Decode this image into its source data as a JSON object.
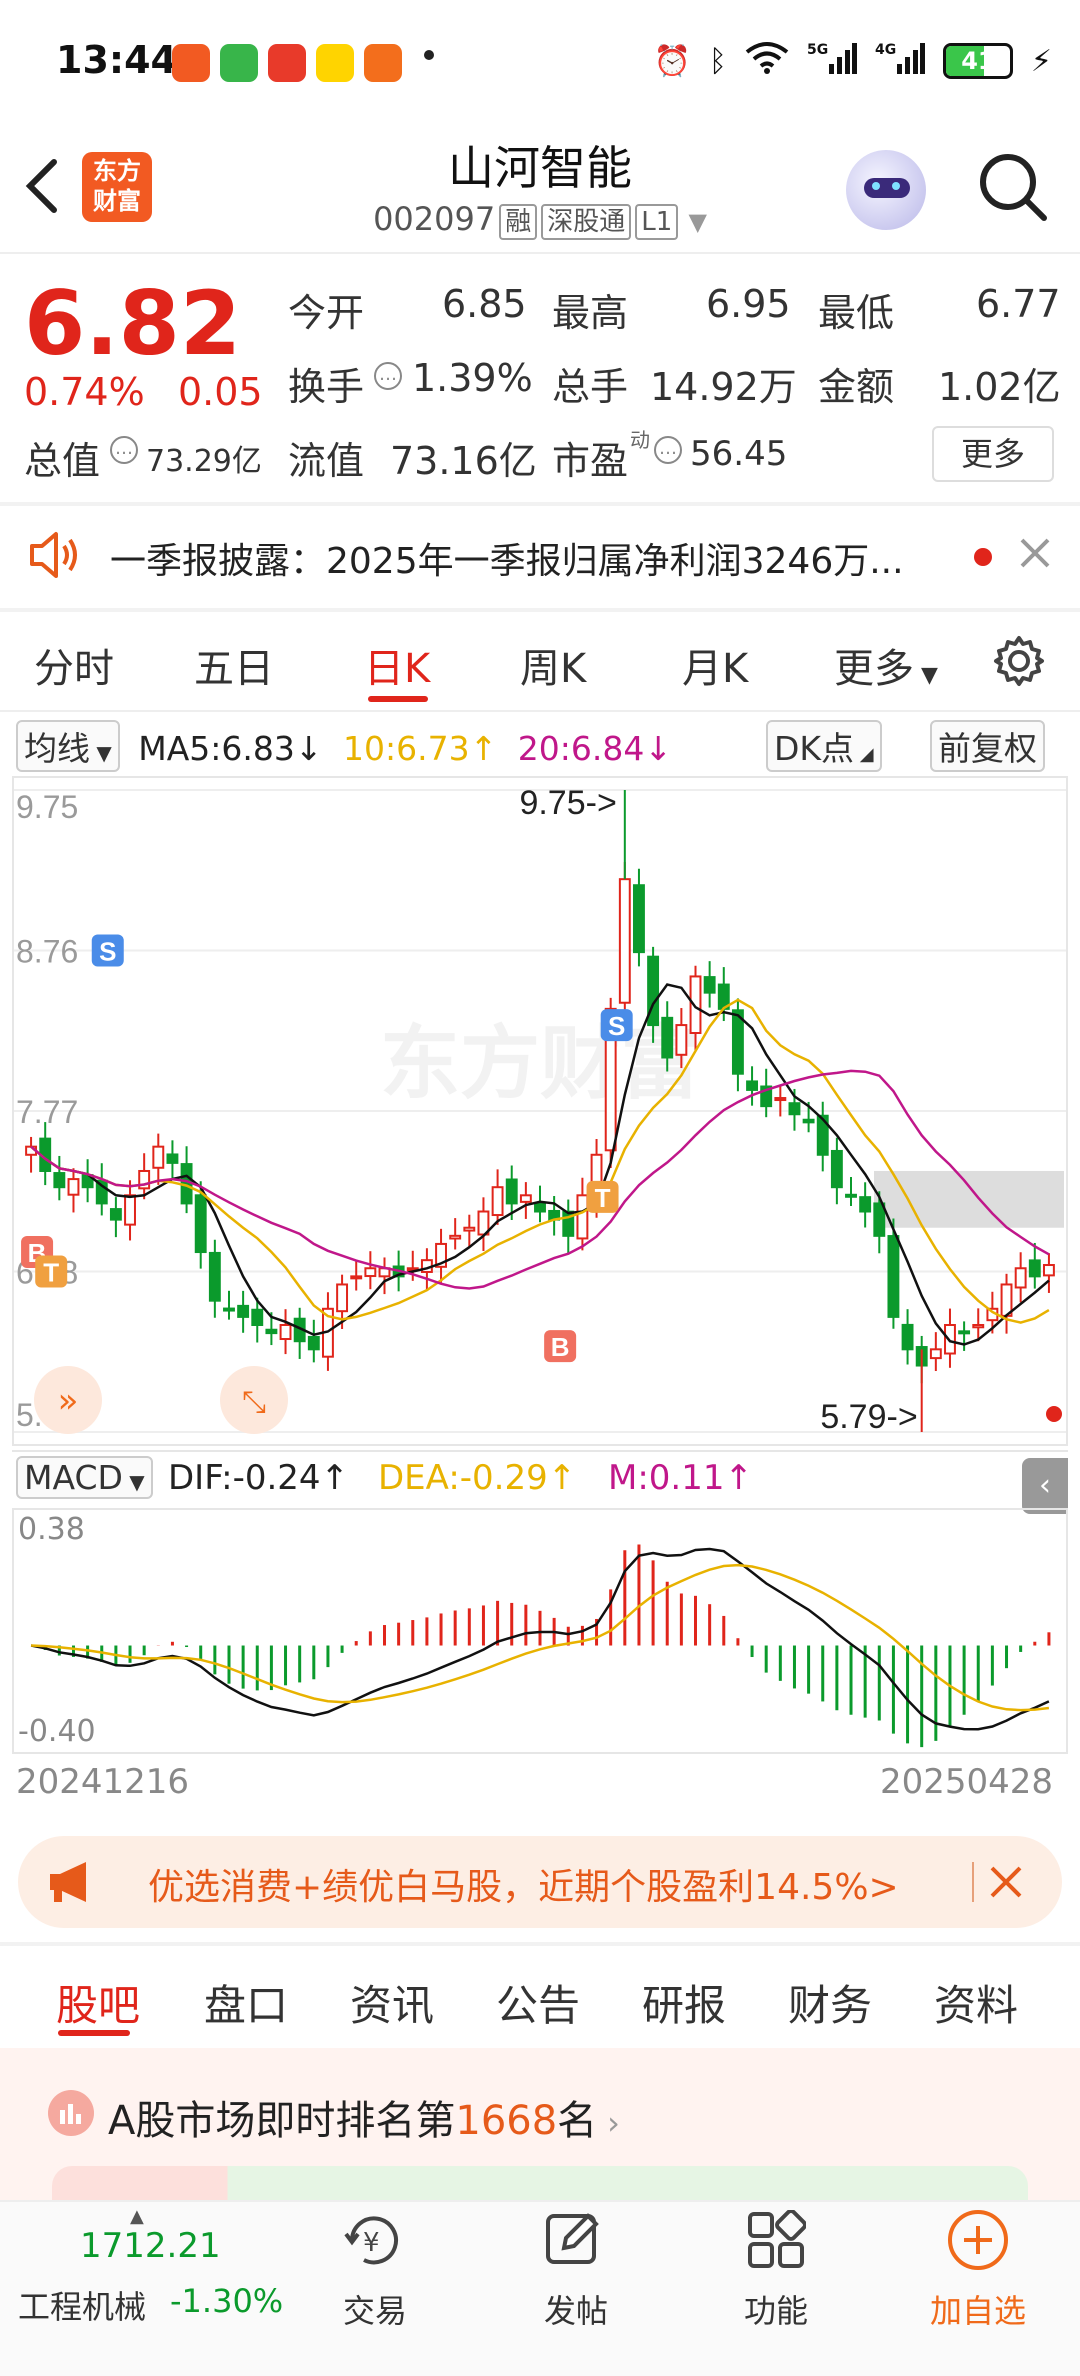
{
  "status_bar": {
    "time": "13:44",
    "battery": "41"
  },
  "header": {
    "title": "山河智能",
    "code": "002097",
    "tags": [
      "融",
      "深股通",
      "L1"
    ],
    "logo_lines": [
      "东方",
      "财富"
    ]
  },
  "quote": {
    "price": "6.82",
    "change_pct": "0.74%",
    "change": "0.05",
    "rows": [
      [
        {
          "label": "今开",
          "value": "6.85",
          "color": "#e0251b"
        },
        {
          "label": "最高",
          "value": "6.95",
          "color": "#e0251b"
        },
        {
          "label": "最低",
          "value": "6.77",
          "color": "#333333"
        }
      ],
      [
        {
          "label": "换手",
          "value": "1.39%",
          "color": "#333333"
        },
        {
          "label": "总手",
          "value": "14.92万",
          "color": "#333333"
        },
        {
          "label": "金额",
          "value": "1.02亿",
          "color": "#333333"
        }
      ]
    ],
    "total_value_label": "总值",
    "total_value": "73.29亿",
    "float_label": "流值",
    "float_value": "73.16亿",
    "pe_label": "市盈",
    "pe_sup": "动",
    "pe_value": "56.45",
    "more_label": "更多"
  },
  "notice": {
    "text": "一季报披露：2025年一季报归属净利润3246万..."
  },
  "kline_tabs": [
    "分时",
    "五日",
    "日K",
    "周K",
    "月K",
    "更多"
  ],
  "active_kline_tab": "日K",
  "ma": {
    "selector": "均线",
    "ma5": "MA5:6.83↓",
    "ma10": "10:6.73↑",
    "ma20": "20:6.84↓",
    "dk": "DK点",
    "adjust": "前复权"
  },
  "chart_data": {
    "type": "candlestick",
    "y_ticks": [
      "9.75",
      "8.76",
      "7.77",
      "6.78",
      "5.79"
    ],
    "ylim": [
      5.79,
      9.75
    ],
    "high_label": "9.75->",
    "low_label": "5.79->",
    "markers": [
      "S",
      "S",
      "B",
      "B",
      "T",
      "T"
    ],
    "start_date": "20241216",
    "end_date": "20250428",
    "watermark": "东方财富",
    "candles_close": [
      7.55,
      7.4,
      7.3,
      7.35,
      7.3,
      7.2,
      7.1,
      7.25,
      7.4,
      7.55,
      7.45,
      7.2,
      6.9,
      6.6,
      6.55,
      6.5,
      6.45,
      6.4,
      6.45,
      6.35,
      6.3,
      6.55,
      6.7,
      6.75,
      6.8,
      6.8,
      6.75,
      6.8,
      6.85,
      6.95,
      7.0,
      7.05,
      7.15,
      7.3,
      7.2,
      7.25,
      7.15,
      7.1,
      7.0,
      7.25,
      7.5,
      8.4,
      9.2,
      8.75,
      8.3,
      8.1,
      8.3,
      8.6,
      8.5,
      8.4,
      8.0,
      7.9,
      7.8,
      7.85,
      7.75,
      7.7,
      7.5,
      7.3,
      7.25,
      7.15,
      7.0,
      6.5,
      6.3,
      6.2,
      6.3,
      6.45,
      6.4,
      6.45,
      6.55,
      6.7,
      6.8,
      6.75,
      6.82
    ]
  },
  "macd": {
    "selector": "MACD",
    "dif": "DIF:-0.24↑",
    "dea": "DEA:-0.29↑",
    "m": "M:0.11↑",
    "top": "0.38",
    "bottom": "-0.40"
  },
  "dates": {
    "start": "20241216",
    "end": "20250428"
  },
  "promo": {
    "text": "优选消费+绩优白马股，近期个股盈利14.5%>"
  },
  "content_tabs": [
    "股吧",
    "盘口",
    "资讯",
    "公告",
    "研报",
    "财务",
    "资料"
  ],
  "active_content_tab": "股吧",
  "rank": {
    "prefix": "A股市场即时排名第",
    "number": "1668",
    "suffix": "名"
  },
  "bottom_nav": {
    "index_value": "1712.21",
    "index_name": "工程机械",
    "index_change": "-1.30%",
    "items": [
      "交易",
      "发帖",
      "功能",
      "加自选"
    ]
  }
}
